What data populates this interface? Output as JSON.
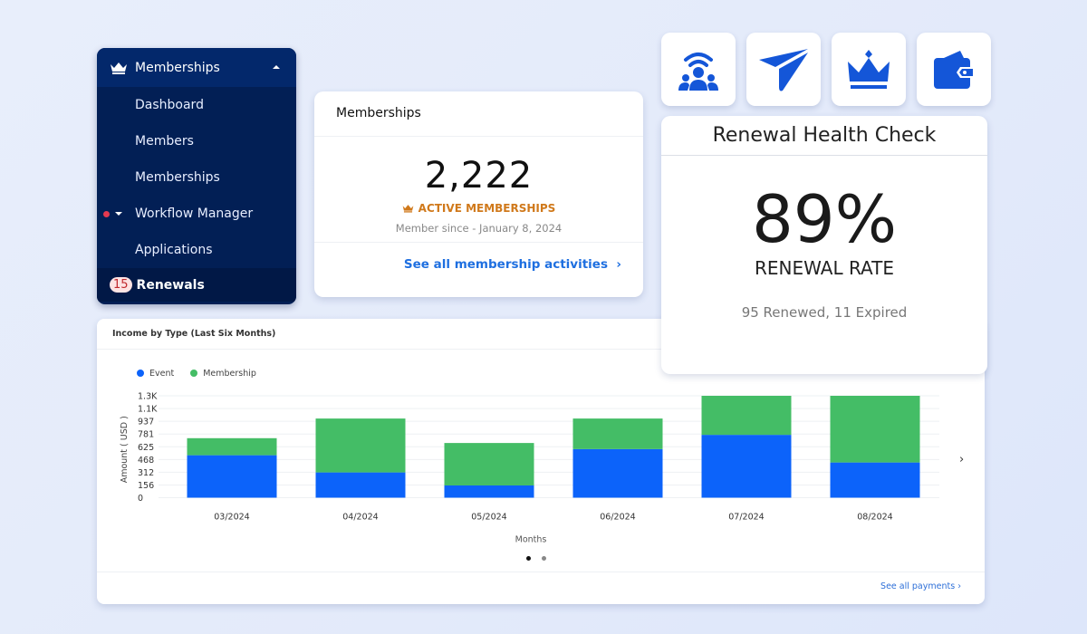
{
  "colors": {
    "event": "#0c63fa",
    "membership": "#44bd66",
    "sidebar_bg": "#021f55",
    "accent_blue": "#1456d8",
    "orange": "#d0791b"
  },
  "sidebar": {
    "header": {
      "label": "Memberships",
      "icon": "crown-icon",
      "expanded": true
    },
    "items": [
      {
        "label": "Dashboard"
      },
      {
        "label": "Members"
      },
      {
        "label": "Memberships"
      },
      {
        "label": "Workflow Manager",
        "notification_dot": true,
        "collapsible": true
      },
      {
        "label": "Applications"
      },
      {
        "label": "Renewals",
        "badge": "15",
        "active": true
      }
    ]
  },
  "memberships_card": {
    "title": "Memberships",
    "value": "2,222",
    "label": "ACTIVE MEMBERSHIPS",
    "since": "Member since - January 8, 2024",
    "link": "See all membership activities",
    "link_arrow": "›"
  },
  "quick_actions": [
    {
      "icon": "community-broadcast-icon"
    },
    {
      "icon": "send-plane-icon"
    },
    {
      "icon": "crown-icon"
    },
    {
      "icon": "wallet-icon"
    }
  ],
  "renewal_card": {
    "title": "Renewal Health Check",
    "value": "89%",
    "label": "RENEWAL RATE",
    "sub": "95 Renewed, 11 Expired"
  },
  "income_card": {
    "title": "Income by Type (Last Six Months)",
    "next_arrow": "›",
    "page_count": 2,
    "current_page": 1,
    "footer_link": "See all payments ›"
  },
  "chart_data": {
    "type": "bar",
    "stacked": true,
    "title": "Income by Type (Last Six Months)",
    "xlabel": "Months",
    "ylabel": "Amount ( USD )",
    "categories": [
      "03/2024",
      "04/2024",
      "05/2024",
      "06/2024",
      "07/2024",
      "08/2024"
    ],
    "series": [
      {
        "name": "Event",
        "values": [
          521,
          310,
          150,
          596,
          771,
          432
        ]
      },
      {
        "name": "Membership",
        "values": [
          209,
          661,
          521,
          375,
          486,
          825
        ]
      }
    ],
    "y_ticks": [
      "0",
      "156",
      "312",
      "468",
      "625",
      "781",
      "937",
      "1.1K",
      "1.3K"
    ],
    "y_tick_values": [
      0,
      156,
      312,
      468,
      625,
      781,
      937,
      1093,
      1250
    ],
    "ylim": [
      0,
      1250
    ],
    "grid": true,
    "legend": "top-left"
  }
}
